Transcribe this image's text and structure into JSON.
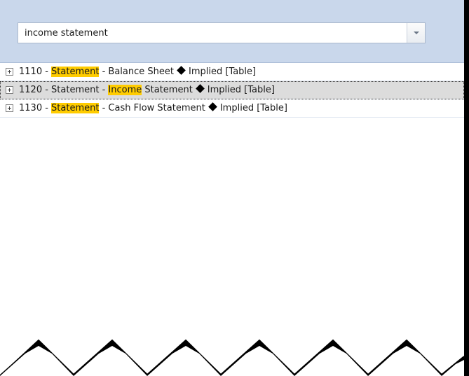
{
  "search": {
    "value": "income statement"
  },
  "colors": {
    "panel": "#c9d7eb",
    "highlight": "#ffcc00",
    "selected_row": "#dcdcdc"
  },
  "icons": {
    "expander": "plus-box-icon",
    "dropdown": "chevron-down-icon",
    "separator": "diamond-icon"
  },
  "tree": {
    "rows": [
      {
        "prefix": "1110 - ",
        "hl1": "Statement",
        "mid": " - Balance Sheet",
        "hl2": "",
        "after": "",
        "suffix": "Implied [Table]"
      },
      {
        "prefix": "1120 - Statement - ",
        "hl1": "",
        "mid": "",
        "hl2": "Income",
        "after": " Statement",
        "suffix": "Implied [Table]"
      },
      {
        "prefix": "1130 - ",
        "hl1": "Statement",
        "mid": " - Cash Flow Statement",
        "hl2": "",
        "after": "",
        "suffix": "Implied [Table]"
      }
    ]
  }
}
